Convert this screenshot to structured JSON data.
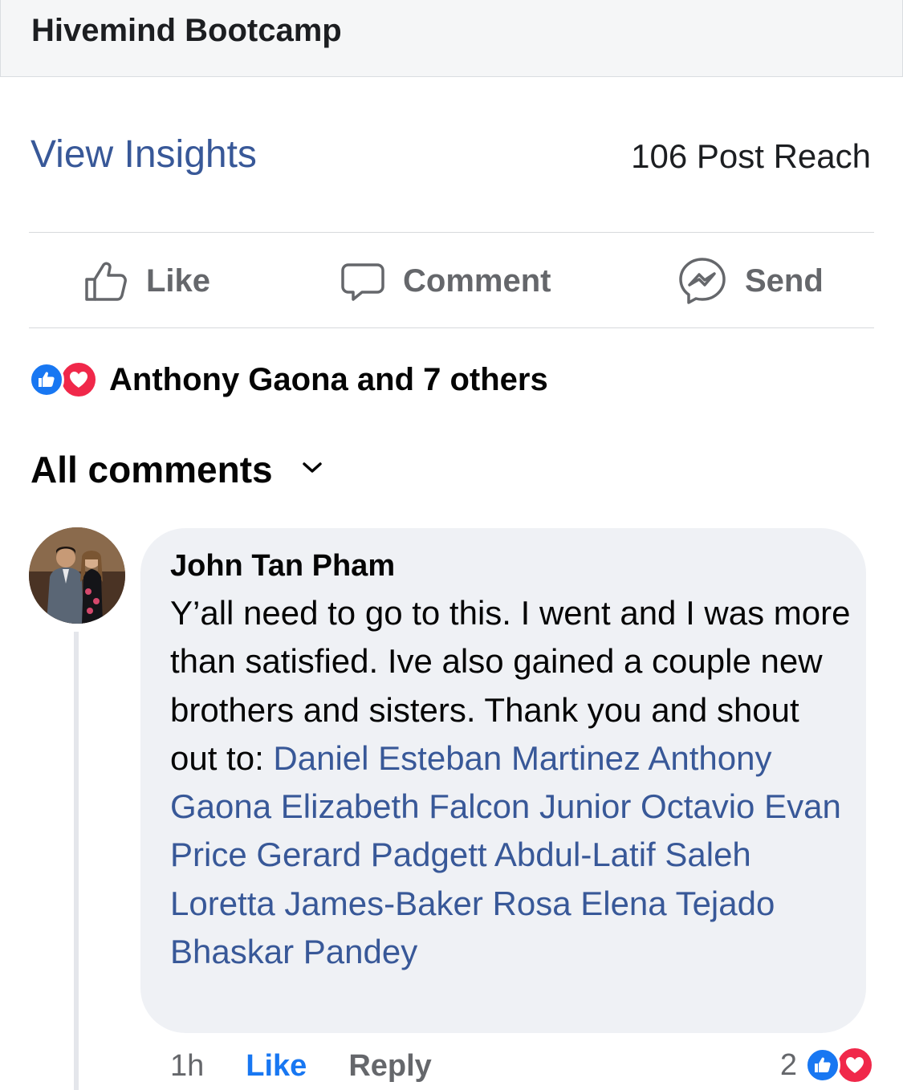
{
  "header": {
    "title": "Hivemind Bootcamp"
  },
  "insights": {
    "link_label": "View Insights",
    "reach": "106 Post Reach"
  },
  "actions": {
    "like_label": "Like",
    "comment_label": "Comment",
    "send_label": "Send"
  },
  "reactions": {
    "types": [
      "like",
      "love"
    ],
    "summary": "Anthony Gaona and 7 others"
  },
  "comments_filter": {
    "label": "All comments"
  },
  "comment": {
    "author": "John Tan Pham",
    "text_intro": "Y’all need to go to this. I went and I was more than satisfied. Ive also gained a couple new brothers and sisters. Thank you and shout out to: ",
    "mentions": [
      "Daniel Esteban Martinez",
      "Anthony Gaona",
      "Elizabeth Falcon",
      "Junior Octavio",
      "Evan Price",
      "Gerard Padgett",
      "Abdul-Latif Saleh",
      "Loretta James-Baker",
      "Rosa Elena Tejado",
      "Bhaskar Pandey"
    ],
    "time": "1h",
    "like_label": "Like",
    "reply_label": "Reply",
    "reaction_count": "2",
    "reaction_types": [
      "like",
      "love"
    ]
  },
  "colors": {
    "link_blue": "#385898",
    "fb_blue": "#1877f2",
    "love_red": "#f0284a",
    "muted_gray": "#65676b",
    "bubble_bg": "#eff1f5"
  }
}
